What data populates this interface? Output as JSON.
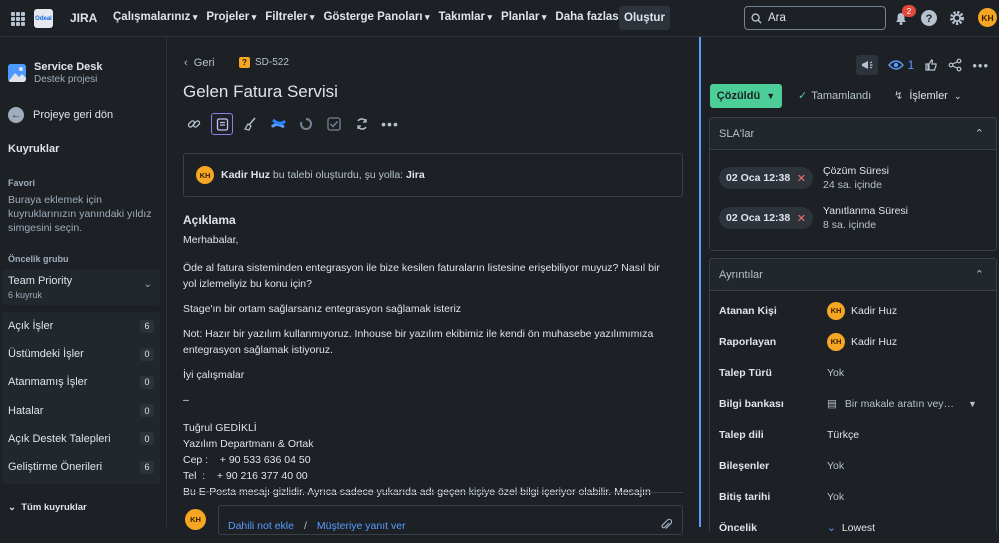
{
  "topnav": {
    "logo_text": "Odeal",
    "brand": "JIRA",
    "menu": [
      "Çalışmalarınız",
      "Projeler",
      "Filtreler",
      "Gösterge Panoları",
      "Takımlar",
      "Planlar",
      "Daha fazlası"
    ],
    "create_label": "Oluştur",
    "search_placeholder": "Ara",
    "notification_count": "2",
    "avatar_initials": "KH"
  },
  "sidebar": {
    "project_name": "Service Desk",
    "project_type": "Destek projesi",
    "back_label": "Projeye geri dön",
    "queues_heading": "Kuyruklar",
    "favorites_heading": "Favori",
    "favorites_hint": "Buraya eklemek için kuyruklarınızın yanındaki yıldız simgesini seçin.",
    "priority_heading": "Öncelik grubu",
    "priority_group": {
      "title": "Team Priority",
      "sub": "6 kuyruk"
    },
    "queues": [
      {
        "label": "Açık İşler",
        "count": "6"
      },
      {
        "label": "Üstümdeki İşler",
        "count": "0"
      },
      {
        "label": "Atanmamış İşler",
        "count": "0"
      },
      {
        "label": "Hatalar",
        "count": "0"
      },
      {
        "label": "Açık Destek Talepleri",
        "count": "0"
      },
      {
        "label": "Geliştirme Önerileri",
        "count": "6"
      }
    ],
    "all_queues": "Tüm kuyruklar"
  },
  "issue": {
    "back_label": "Geri",
    "key": "SD-522",
    "title": "Gelen Fatura Servisi",
    "creator": {
      "initials": "KH",
      "name": "Kadir Huz",
      "text_mid": " bu talebi oluşturdu, şu yolla: ",
      "via": "Jira"
    },
    "description_heading": "Açıklama",
    "description": {
      "greeting": "Merhabalar,",
      "p1": "Öde al fatura sisteminden entegrasyon ile bize kesilen faturaların listesine erişebiliyor muyuz? Nasıl bir yol izlemeliyiz bu konu için?",
      "p2": "Stage'ın bir ortam sağlarsanız entegrasyon sağlamak isteriz",
      "p3": "Not: Hazır bir yazılım kullanmıyoruz. Inhouse bir yazılım ekibimiz ile kendi ön muhasebe yazılımımıza entegrasyon sağlamak istiyoruz.",
      "p4": "İyi çalışmalar",
      "dash": "–",
      "sig_name": "Tuğrul GEDİKLİ",
      "sig_dept": "Yazılım Departmanı & Ortak",
      "sig_cep": "Cep :    + 90 533 636 04 50",
      "sig_tel": "Tel  :    + 90 216 377 40 00",
      "disclaimer": "Bu E-Posta mesajı gizlidir. Ayrıca sadece yukarıda adı geçen kişiye özel bilgi içeriyor olabilir. Mesajın"
    },
    "comment": {
      "initials": "KH",
      "internal_note": "Dahili not ekle",
      "separator": "/",
      "reply_customer": "Müşteriye yanıt ver"
    }
  },
  "rightpanel": {
    "watch_count": "1",
    "status_label": "Çözüldü",
    "done_label": "Tamamlandı",
    "ops_label": "İşlemler",
    "sla_heading": "SLA'lar",
    "slas": [
      {
        "time": "02 Oca 12:38",
        "name": "Çözüm Süresi",
        "sub": "24 sa. içinde"
      },
      {
        "time": "02 Oca 12:38",
        "name": "Yanıtlanma Süresi",
        "sub": "8 sa. içinde"
      }
    ],
    "details_heading": "Ayrıntılar",
    "details": {
      "assignee_label": "Atanan Kişi",
      "assignee_initials": "KH",
      "assignee": "Kadir Huz",
      "reporter_label": "Raporlayan",
      "reporter_initials": "KH",
      "reporter": "Kadir Huz",
      "request_type_label": "Talep Türü",
      "request_type": "Yok",
      "kb_label": "Bilgi bankası",
      "kb_value": "Bir makale aratın vey…",
      "lang_label": "Talep dili",
      "lang": "Türkçe",
      "components_label": "Bileşenler",
      "components": "Yok",
      "due_label": "Bitiş tarihi",
      "due": "Yok",
      "priority_label": "Öncelik",
      "priority": "Lowest"
    }
  }
}
